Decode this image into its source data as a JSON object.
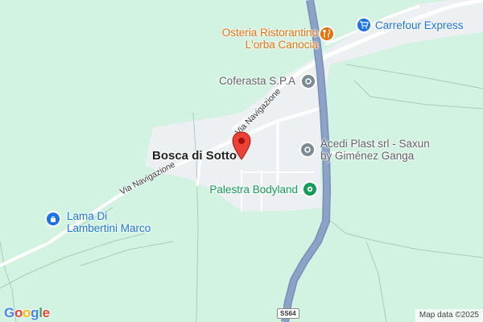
{
  "map": {
    "town_label": "Bosca di Sotto",
    "road_labels": {
      "via_navigazione_1": "Via Navigazione",
      "via_navigazione_2": "Via Navigazione"
    },
    "highway_shield": "SS64",
    "pois": {
      "restaurant": {
        "line1": "Osteria Ristorantino",
        "line2": "L'orba Canocia",
        "icon": "restaurant-icon",
        "color": "#e8710a"
      },
      "supermarket": {
        "line1": "Carrefour Express",
        "icon": "shopping-cart-icon",
        "color": "#1a73e8"
      },
      "coferasta": {
        "line1": "Coferasta S.P.A",
        "icon": "business-icon",
        "color": "#7b8a93"
      },
      "acedi": {
        "line1": "Acedi Plast srl - Saxun",
        "line2": "by Giménez Ganga",
        "icon": "business-icon",
        "color": "#7b8a93"
      },
      "gym": {
        "line1": "Palestra Bodyland",
        "icon": "gym-icon",
        "color": "#0f9d58"
      },
      "lama": {
        "line1": "Lama Di",
        "line2": "Lambertini Marco",
        "icon": "shopping-bag-icon",
        "color": "#1a73e8"
      }
    },
    "logo": "Google",
    "attribution": "Map data ©2025"
  },
  "colors": {
    "park_background": "#d2f3e1",
    "built_area": "#edf0f2",
    "highway": "#8ca2c6",
    "highway_border": "#7a8fb5",
    "marker": "#ea4335"
  }
}
